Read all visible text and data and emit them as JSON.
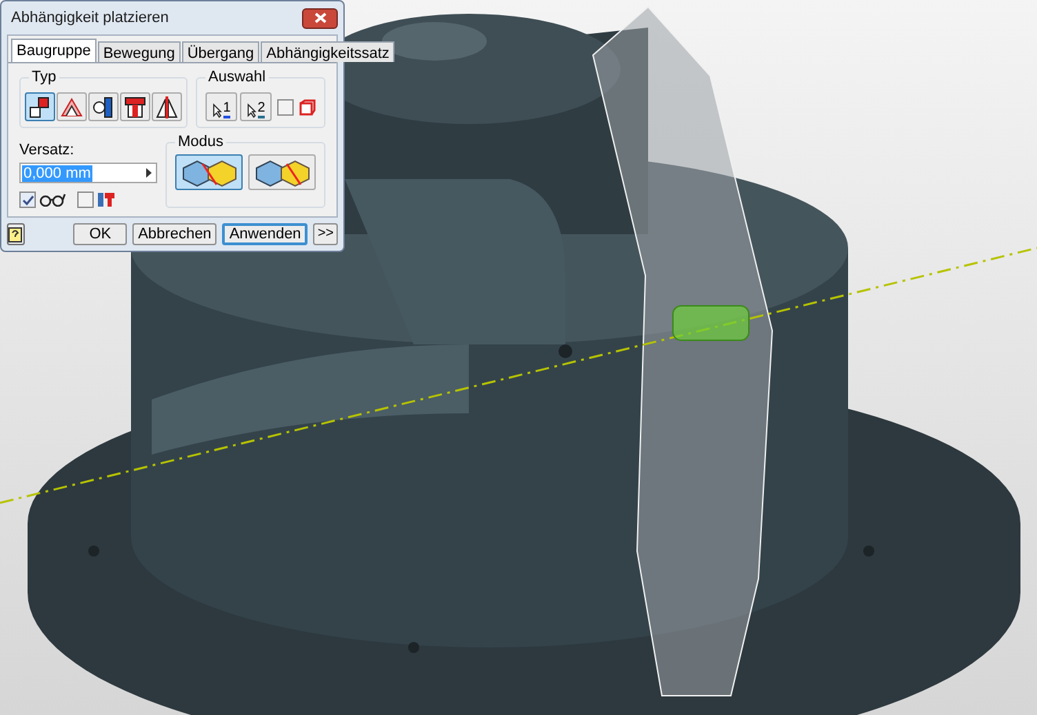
{
  "dialog": {
    "title": "Abhängigkeit platzieren",
    "tabs": [
      {
        "label": "Baugruppe",
        "selected": true
      },
      {
        "label": "Bewegung",
        "selected": false
      },
      {
        "label": "Übergang",
        "selected": false
      },
      {
        "label": "Abhängigkeitssatz",
        "selected": false
      }
    ],
    "type_group": {
      "label": "Typ",
      "buttons": [
        {
          "selected": true
        },
        {
          "selected": false
        },
        {
          "selected": false
        },
        {
          "selected": false
        },
        {
          "selected": false
        }
      ]
    },
    "selection_group": {
      "label": "Auswahl",
      "buttons": [
        {
          "label": "1"
        },
        {
          "label": "2"
        }
      ],
      "checkbox": {
        "checked": false
      }
    },
    "offset": {
      "label": "Versatz:",
      "value": "0,000 mm"
    },
    "options": [
      {
        "checked": true
      },
      {
        "checked": false
      }
    ],
    "mode_group": {
      "label": "Modus",
      "buttons": [
        {
          "selected": true
        },
        {
          "selected": false
        }
      ]
    },
    "buttons": [
      {
        "label": "OK",
        "default": false
      },
      {
        "label": "Abbrechen",
        "default": false
      },
      {
        "label": "Anwenden",
        "default": true
      }
    ],
    "more_button": ">>"
  }
}
